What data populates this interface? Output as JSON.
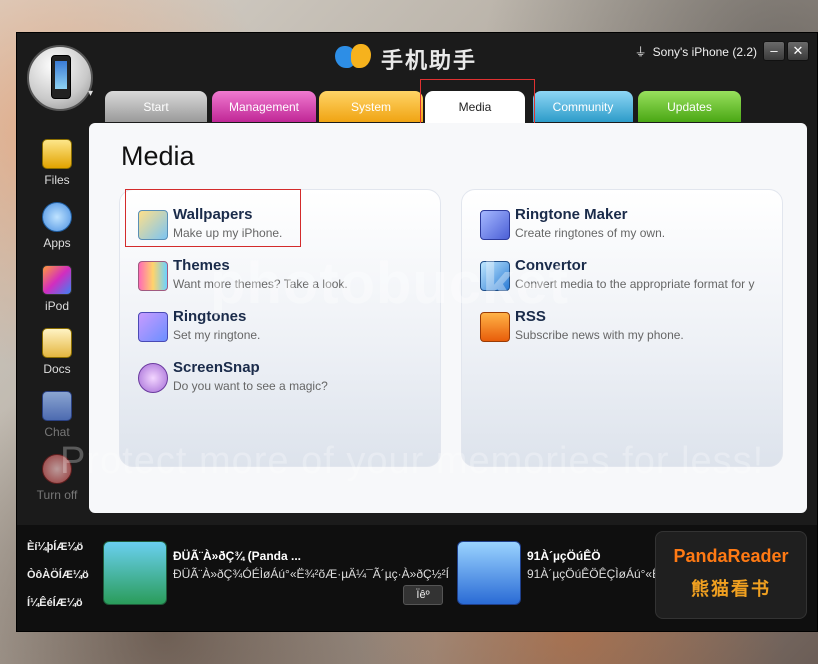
{
  "app": {
    "title": "手机助手",
    "device": "Sony's iPhone (2.2)",
    "min_label": "‒",
    "close_label": "✕",
    "menu_caret": "▾"
  },
  "tabs": [
    {
      "label": "Start"
    },
    {
      "label": "Management"
    },
    {
      "label": "System"
    },
    {
      "label": "Media",
      "selected": true
    },
    {
      "label": "Community"
    },
    {
      "label": "Updates"
    }
  ],
  "sidebar": {
    "items": [
      {
        "label": "Files",
        "icon": "folder-icon",
        "enabled": true
      },
      {
        "label": "Apps",
        "icon": "apps-icon",
        "enabled": true
      },
      {
        "label": "iPod",
        "icon": "ipod-icon",
        "enabled": true
      },
      {
        "label": "Docs",
        "icon": "docs-icon",
        "enabled": true
      },
      {
        "label": "Chat",
        "icon": "chat-icon",
        "enabled": false
      },
      {
        "label": "Turn off",
        "icon": "power-icon",
        "enabled": false
      }
    ]
  },
  "main": {
    "title": "Media",
    "left_features": [
      {
        "title": "Wallpapers",
        "desc": "Make up my iPhone.",
        "icon": "wallpaper-icon"
      },
      {
        "title": "Themes",
        "desc": "Want more themes? Take a look.",
        "icon": "themes-icon"
      },
      {
        "title": "Ringtones",
        "desc": "Set my ringtone.",
        "icon": "ringtone-icon"
      },
      {
        "title": "ScreenSnap",
        "desc": "Do you want to see a magic?",
        "icon": "screensnap-icon"
      }
    ],
    "right_features": [
      {
        "title": "Ringtone Maker",
        "desc": "Create ringtones of my own.",
        "icon": "ringtone-maker-icon"
      },
      {
        "title": "Convertor",
        "desc": "Convert media to the appropriate format for y",
        "icon": "convertor-icon"
      },
      {
        "title": "RSS",
        "desc": "Subscribe news with my phone.",
        "icon": "rss-icon"
      }
    ]
  },
  "watermark": {
    "line1": "photobucket",
    "line2": "Protect more of your memories for less!"
  },
  "bottom": {
    "links": [
      "Èí¼þÍÆ¼ö",
      "ÒôÀÖÍÆ¼ö",
      "Í¼ÊéÍÆ¼ö"
    ],
    "ad1": {
      "title": "ÐÜÃ¨À»ðÇ¾ (Panda ...",
      "sub": "ÐÜÃ¨À»ðÇ¾ÓÉÌøÁú°«Ë¾²õÆ·µÄ¼¯Ã´µç·À»ðÇ½²Í...",
      "button": "Ïêº"
    },
    "ad2": {
      "title": "91À´µçÖúÊÖ",
      "sub": "91À´µçÖúÊÖÊÇÌøÁú°«Ë..."
    },
    "banner": {
      "title": "PandaReader",
      "sub": "熊猫看书"
    }
  }
}
